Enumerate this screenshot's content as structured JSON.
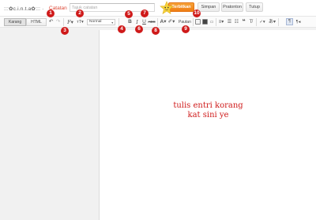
{
  "header": {
    "blog_name": ":::✿c.i.n.t.a✿:::",
    "separator": "·",
    "post_label": "Catatan",
    "title_placeholder": "Tajuk catatan",
    "publish_label": "Terbitkan",
    "save_label": "Simpan",
    "preview_label": "Pratonton",
    "close_label": "Tutup"
  },
  "toolbar": {
    "compose_label": "Karang",
    "html_label": "HTML",
    "font_label": "Normal",
    "link_label": "Pautan",
    "bold_label": "B",
    "italic_label": "I",
    "underline_label": "U",
    "strike_label": "ABC"
  },
  "markers": [
    "1",
    "2",
    "3",
    "4",
    "5",
    "6",
    "7",
    "8",
    "9",
    "10"
  ],
  "editor": {
    "line1": "tulis entri korang",
    "line2": "kat sini ye"
  },
  "colors": {
    "accent_red": "#cf1a1a",
    "publish_orange": "#ef7d13",
    "star_yellow": "#f5d23a"
  }
}
